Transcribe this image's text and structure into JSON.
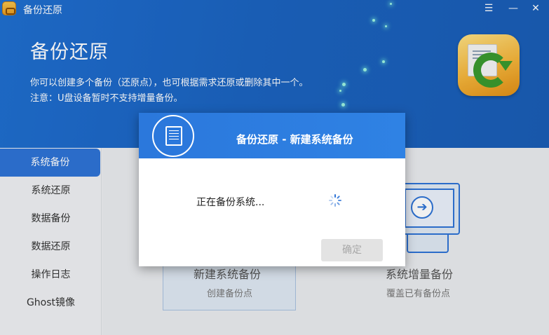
{
  "window": {
    "title": "备份还原",
    "controls": {
      "menu": "☰",
      "minimize": "—",
      "close": "✕"
    }
  },
  "banner": {
    "title": "备份还原",
    "desc_line1": "你可以创建多个备份（还原点），也可根据需求还原或删除其中一个。",
    "desc_line2": "注意：U盘设备暂时不支持增量备份。"
  },
  "sidebar": {
    "items": [
      {
        "label": "系统备份",
        "active": true
      },
      {
        "label": "系统还原"
      },
      {
        "label": "数据备份"
      },
      {
        "label": "数据还原"
      },
      {
        "label": "操作日志"
      },
      {
        "label": "Ghost镜像"
      }
    ]
  },
  "main": {
    "cards": [
      {
        "title": "新建系统备份",
        "subtitle": "创建备份点"
      },
      {
        "title": "系统增量备份",
        "subtitle": "覆盖已有备份点"
      }
    ]
  },
  "dialog": {
    "title": "备份还原 - 新建系统备份",
    "message": "正在备份系统...",
    "ok_label": "确定"
  },
  "colors": {
    "accent": "#2e73d6",
    "banner": "#1f6fd0"
  }
}
